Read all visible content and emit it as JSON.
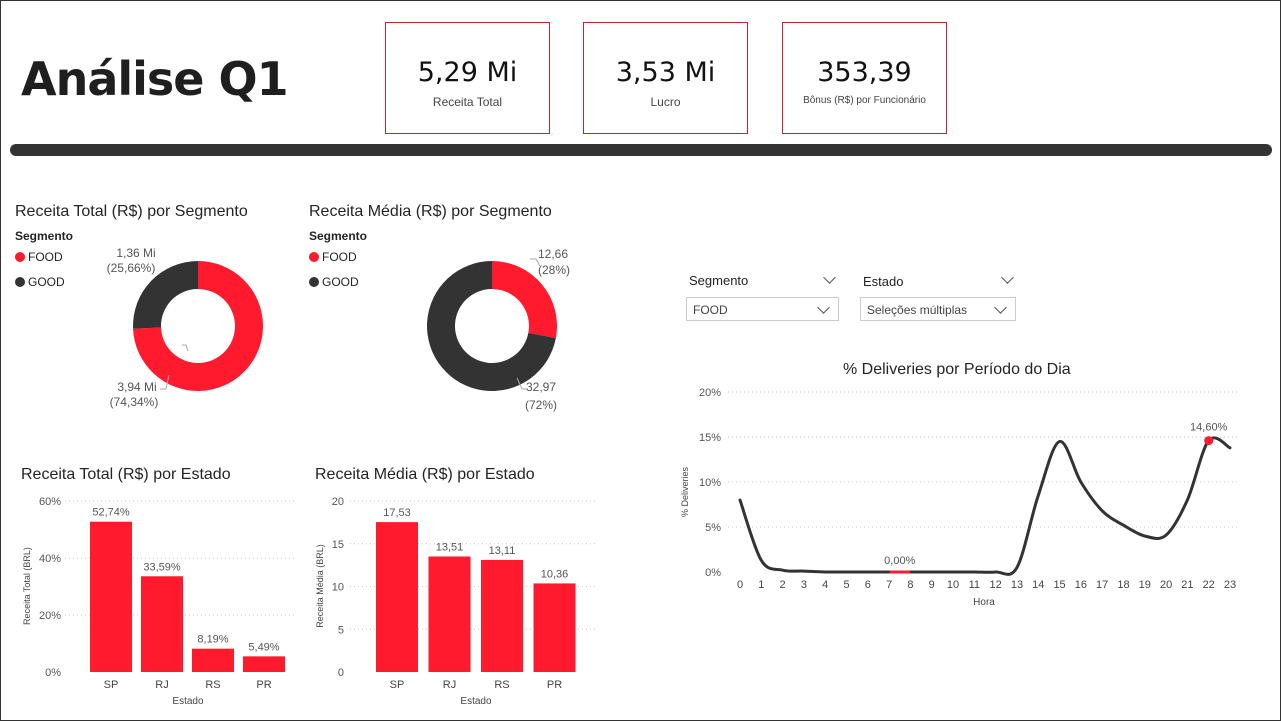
{
  "page_title": "Análise Q1",
  "kpis": [
    {
      "value": "5,29 Mi",
      "label": "Receita Total"
    },
    {
      "value": "3,53 Mi",
      "label": "Lucro"
    },
    {
      "value": "353,39",
      "label": "Bônus (R$) por Funcionário"
    }
  ],
  "slicers": {
    "segmento": {
      "label": "Segmento",
      "selected": "FOOD"
    },
    "estado": {
      "label": "Estado",
      "selected": "Seleções múltiplas"
    }
  },
  "colors": {
    "food": "#ff1a2e",
    "good": "#333333",
    "line": "#333333",
    "accent": "#c4242f"
  },
  "chart_data": [
    {
      "type": "pie",
      "title": "Receita Total (R$) por Segmento",
      "legend_title": "Segmento",
      "legend_position": "top-left",
      "categories": [
        "FOOD",
        "GOOD"
      ],
      "values": [
        74.34,
        25.66
      ],
      "data_labels": [
        {
          "value": "3,94 Mi",
          "percent": "(74,34%)"
        },
        {
          "value": "1,36 Mi",
          "percent": "(25,66%)"
        }
      ]
    },
    {
      "type": "pie",
      "title": "Receita Média (R$) por Segmento",
      "legend_title": "Segmento",
      "legend_position": "top-left",
      "categories": [
        "FOOD",
        "GOOD"
      ],
      "values": [
        28,
        72
      ],
      "data_labels": [
        {
          "value": "12,66",
          "percent": "(28%)"
        },
        {
          "value": "32,97",
          "percent": "(72%)"
        }
      ]
    },
    {
      "type": "bar",
      "title": "Receita Total (R$) por Estado",
      "xlabel": "Estado",
      "ylabel": "Receita Total (BRL)",
      "categories": [
        "SP",
        "RJ",
        "RS",
        "PR"
      ],
      "values": [
        52.74,
        33.59,
        8.19,
        5.49
      ],
      "data_labels": [
        "52,74%",
        "33,59%",
        "8,19%",
        "5,49%"
      ],
      "yticks": [
        0,
        20,
        40,
        60
      ],
      "ytick_labels": [
        "0%",
        "20%",
        "40%",
        "60%"
      ],
      "ylim": [
        0,
        60
      ],
      "grid": true
    },
    {
      "type": "bar",
      "title": "Receita Média (R$) por Estado",
      "xlabel": "Estado",
      "ylabel": "Receita Média (BRL)",
      "categories": [
        "SP",
        "RJ",
        "RS",
        "PR"
      ],
      "values": [
        17.53,
        13.51,
        13.11,
        10.36
      ],
      "data_labels": [
        "17,53",
        "13,51",
        "13,11",
        "10,36"
      ],
      "yticks": [
        0,
        5,
        10,
        15,
        20
      ],
      "ytick_labels": [
        "0",
        "5",
        "10",
        "15",
        "20"
      ],
      "ylim": [
        0,
        20
      ],
      "grid": true
    },
    {
      "type": "line",
      "title": "% Deliveries por Período do Dia",
      "xlabel": "Hora",
      "ylabel": "% Deliveries",
      "x": [
        0,
        1,
        2,
        3,
        4,
        5,
        6,
        7,
        8,
        9,
        10,
        11,
        12,
        13,
        14,
        15,
        16,
        17,
        18,
        19,
        20,
        21,
        22,
        23
      ],
      "values": [
        8.0,
        1.3,
        0.2,
        0.1,
        0,
        0,
        0,
        0,
        0,
        0,
        0,
        0,
        0,
        0.5,
        8.5,
        14.5,
        10.0,
        6.8,
        5.2,
        4.0,
        4.1,
        8.0,
        14.6,
        13.8
      ],
      "yticks": [
        0,
        5,
        10,
        15,
        20
      ],
      "ytick_labels": [
        "0%",
        "5%",
        "10%",
        "15%",
        "20%"
      ],
      "ylim": [
        0,
        20
      ],
      "grid": true,
      "annotations": [
        {
          "x": 22,
          "y": 14.6,
          "label": "14,60%"
        },
        {
          "x": 7.5,
          "y": 0,
          "label": "0,00%"
        }
      ]
    }
  ]
}
